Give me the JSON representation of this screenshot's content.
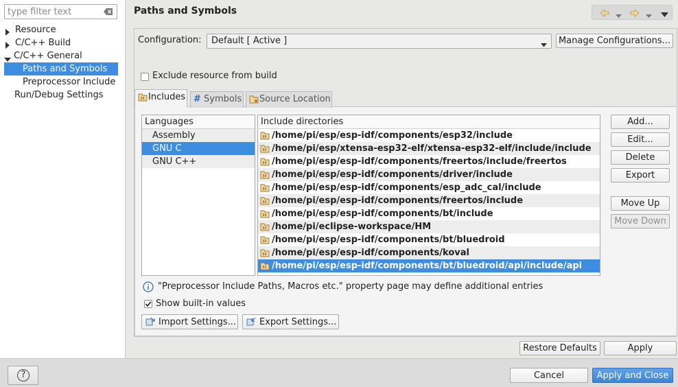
{
  "filter": {
    "placeholder": "type filter text"
  },
  "tree": {
    "items": [
      {
        "label": "Resource"
      },
      {
        "label": "C/C++ Build"
      },
      {
        "label": "C/C++ General"
      },
      {
        "label": "Paths and Symbols"
      },
      {
        "label": "Preprocessor Include"
      },
      {
        "label": "Run/Debug Settings"
      }
    ]
  },
  "page": {
    "title": "Paths and Symbols"
  },
  "config": {
    "label": "Configuration:",
    "value": "Default  [ Active ]",
    "manage_label": "Manage Configurations..."
  },
  "exclude": {
    "label": "Exclude resource from build",
    "checked": false
  },
  "tabs": [
    {
      "label": "Includes",
      "icon": "includes-folder-icon"
    },
    {
      "label": "Symbols",
      "icon": "hash-icon"
    },
    {
      "label": "Source Location",
      "icon": "source-folder-icon"
    }
  ],
  "languages": {
    "header": "Languages",
    "items": [
      "Assembly",
      "GNU C",
      "GNU C++"
    ],
    "selected": "GNU C"
  },
  "includes": {
    "header": "Include directories",
    "items": [
      "/home/pi/esp/esp-idf/components/esp32/include",
      "/home/pi/esp/xtensa-esp32-elf/xtensa-esp32-elf/include/include",
      "/home/pi/esp/esp-idf/components/freertos/include/freertos",
      "/home/pi/esp/esp-idf/components/driver/include",
      "/home/pi/esp/esp-idf/components/esp_adc_cal/include",
      "/home/pi/esp/esp-idf/components/freertos/include",
      "/home/pi/esp/esp-idf/components/bt/include",
      "/home/pi/eclipse-workspace/HM",
      "/home/pi/esp/esp-idf/components/bt/bluedroid",
      "/home/pi/esp/esp-idf/components/koval",
      "/home/pi/esp/esp-idf/components/bt/bluedroid/api/include/api"
    ],
    "selected_index": 10
  },
  "side_buttons": {
    "add": "Add...",
    "edit": "Edit...",
    "delete": "Delete",
    "export": "Export",
    "move_up": "Move Up",
    "move_down": "Move Down"
  },
  "info_text": "\"Preprocessor Include Paths, Macros etc.\" property page may define additional entries",
  "show_builtin": {
    "label": "Show built-in values",
    "checked": true
  },
  "import_settings": "Import Settings...",
  "export_settings": "Export Settings...",
  "restore_defaults": "Restore Defaults",
  "apply": "Apply",
  "dialog": {
    "help": "?",
    "cancel": "Cancel",
    "apply_close": "Apply and Close"
  },
  "colors": {
    "selection": "#3d8ee0",
    "primary_button": "#3b86d8",
    "folder": "#d9a23a"
  }
}
